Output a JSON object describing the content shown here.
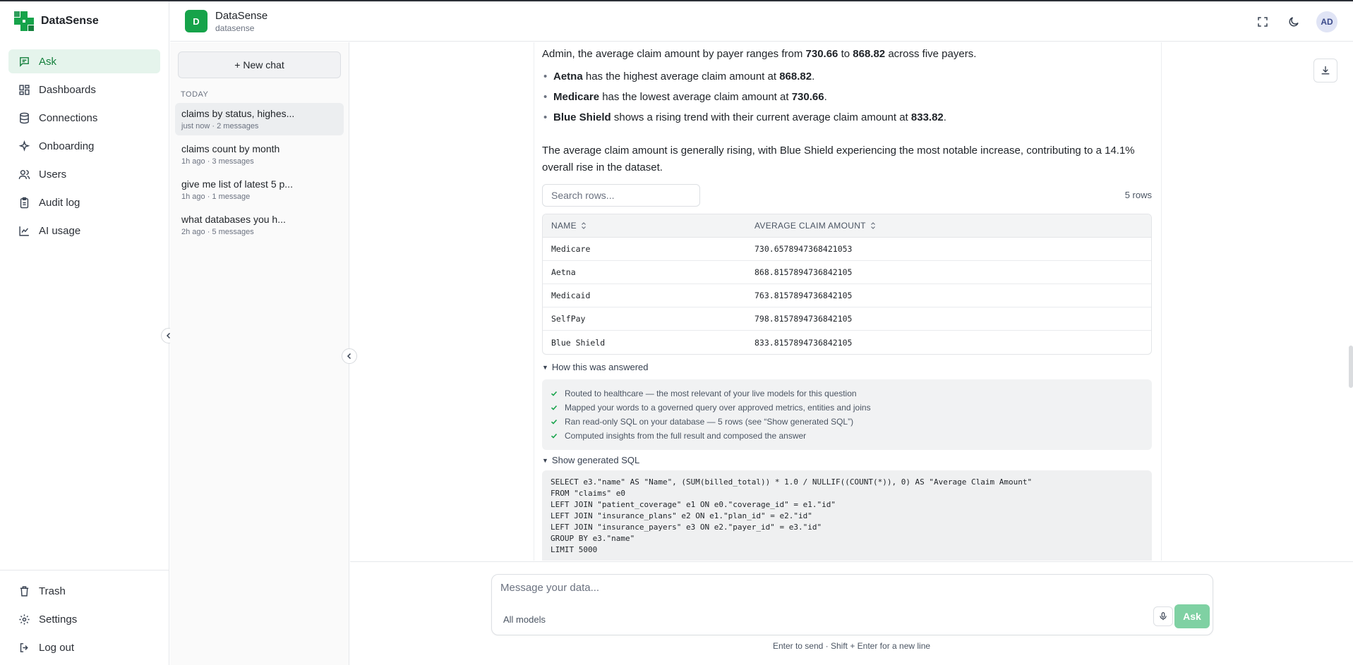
{
  "app": {
    "brand": "DataSense"
  },
  "nav": {
    "items": [
      {
        "label": "Ask",
        "icon": "chat-icon",
        "active": true
      },
      {
        "label": "Dashboards",
        "icon": "grid-icon"
      },
      {
        "label": "Connections",
        "icon": "database-icon"
      },
      {
        "label": "Onboarding",
        "icon": "sparkle-icon"
      },
      {
        "label": "Users",
        "icon": "users-icon"
      },
      {
        "label": "Audit log",
        "icon": "clipboard-icon"
      },
      {
        "label": "AI usage",
        "icon": "chart-line-icon"
      }
    ],
    "bottom": [
      {
        "label": "Trash",
        "icon": "trash-icon"
      },
      {
        "label": "Settings",
        "icon": "gear-icon"
      },
      {
        "label": "Log out",
        "icon": "logout-icon"
      }
    ]
  },
  "workspace": {
    "initial": "D",
    "name": "DataSense",
    "slug": "datasense"
  },
  "user": {
    "initials": "AD"
  },
  "chats": {
    "new_chat_label": "+ New chat",
    "section": "TODAY",
    "items": [
      {
        "title": "claims by status, highes...",
        "meta": "just now · 2 messages",
        "active": true
      },
      {
        "title": "claims count by month",
        "meta": "1h ago · 3 messages"
      },
      {
        "title": "give me list of latest 5 p...",
        "meta": "1h ago · 1 message"
      },
      {
        "title": "what databases you h...",
        "meta": "2h ago · 5 messages"
      }
    ]
  },
  "answer": {
    "intro_pre": "Admin, the average claim amount by payer ranges from ",
    "intro_min": "730.66",
    "intro_mid": " to ",
    "intro_max": "868.82",
    "intro_post": " across five payers.",
    "bullets": [
      {
        "b1": "Aetna",
        "t1": " has the highest average claim amount at ",
        "b2": "868.82",
        "t2": "."
      },
      {
        "b1": "Medicare",
        "t1": " has the lowest average claim amount at ",
        "b2": "730.66",
        "t2": "."
      },
      {
        "b1": "Blue Shield",
        "t1": " shows a rising trend with their current average claim amount at ",
        "b2": "833.82",
        "t2": "."
      }
    ],
    "summary": "The average claim amount is generally rising, with Blue Shield experiencing the most notable increase, contributing to a 14.1% overall rise in the dataset."
  },
  "table": {
    "search_placeholder": "Search rows...",
    "rows_count": "5 rows",
    "columns": [
      "NAME",
      "AVERAGE CLAIM AMOUNT"
    ],
    "rows": [
      [
        "Medicare",
        "730.6578947368421053"
      ],
      [
        "Aetna",
        "868.8157894736842105"
      ],
      [
        "Medicaid",
        "763.8157894736842105"
      ],
      [
        "SelfPay",
        "798.8157894736842105"
      ],
      [
        "Blue Shield",
        "833.8157894736842105"
      ]
    ]
  },
  "how": {
    "label": "How this was answered",
    "steps": [
      "Routed to healthcare — the most relevant of your live models for this question",
      "Mapped your words to a governed query over approved metrics, entities and joins",
      "Ran read-only SQL on your database — 5 rows (see “Show generated SQL”)",
      "Computed insights from the full result and composed the answer"
    ]
  },
  "sql": {
    "label": "Show generated SQL",
    "lines": [
      "SELECT e3.\"name\" AS \"Name\", (SUM(billed_total)) * 1.0 / NULLIF((COUNT(*)), 0) AS \"Average Claim Amount\"",
      "FROM \"claims\" e0",
      "LEFT JOIN \"patient_coverage\" e1 ON e0.\"coverage_id\" = e1.\"id\"",
      "LEFT JOIN \"insurance_plans\" e2 ON e1.\"plan_id\" = e2.\"id\"",
      "LEFT JOIN \"insurance_payers\" e3 ON e2.\"payer_id\" = e3.\"id\"",
      "GROUP BY e3.\"name\"",
      "LIMIT 5000"
    ]
  },
  "composer": {
    "placeholder": "Message your data...",
    "models_label": "All models",
    "ask_label": "Ask",
    "hint": "Enter to send · Shift + Enter for a new line"
  },
  "colors": {
    "accent": "#16a34a",
    "active_bg": "#e5f4ec",
    "ask_button": "#7fd1a3"
  }
}
